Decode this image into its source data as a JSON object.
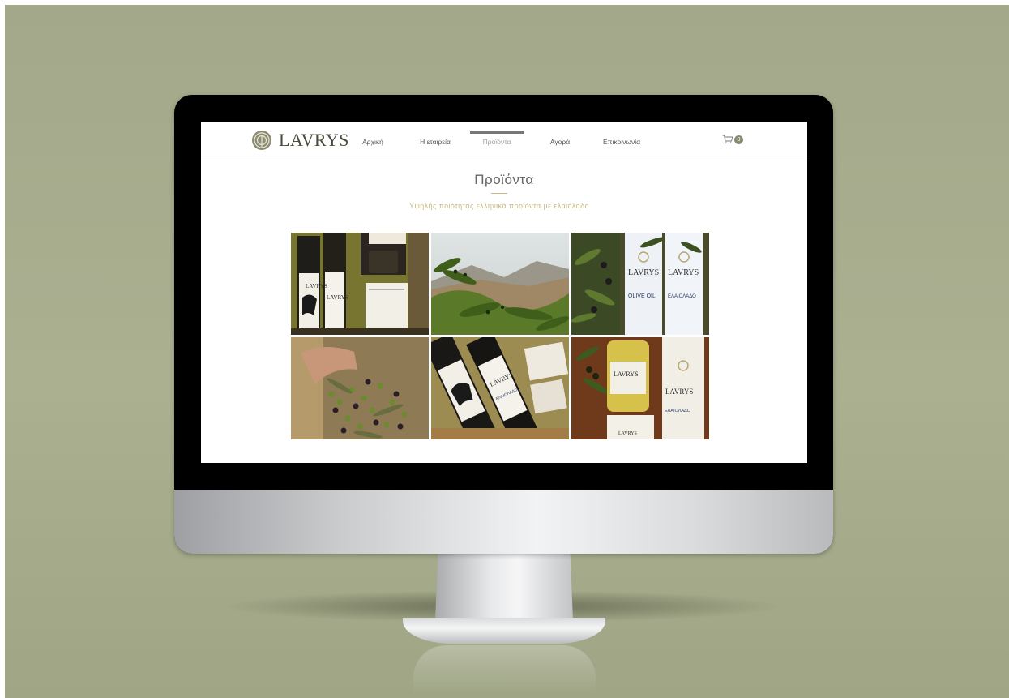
{
  "site": {
    "brand": "LAVRYS",
    "nav": [
      {
        "label": "Αρχική",
        "active": false
      },
      {
        "label": "Η εταιρεία",
        "active": false
      },
      {
        "label": "Προϊόντα",
        "active": true
      },
      {
        "label": "Αγορά",
        "active": false
      },
      {
        "label": "Επικοινωνία",
        "active": false
      }
    ],
    "cart_count": "0"
  },
  "page": {
    "title": "Προϊόντα",
    "subtitle": "Υψηλής ποιότητας ελληνικά προϊόντα με ελαιόλαδο"
  },
  "gallery": {
    "tiles": [
      {
        "name": "gift-box-bottles-photo",
        "bottle_label": "LAVRYS"
      },
      {
        "name": "olive-grove-mountain-photo"
      },
      {
        "name": "olive-oil-bottles-branches-photo",
        "bottle_label": "LAVRYS",
        "product_label": "OLIVE OIL",
        "product_label_gr": "ΕΛΑΙΟΛΑΔΟ"
      },
      {
        "name": "harvested-olives-hand-photo"
      },
      {
        "name": "bottles-in-crate-photo",
        "bottle_label": "LAVRYS",
        "product_label_gr": "ΕΛΑΙΟΛΑΔΟ"
      },
      {
        "name": "oil-jar-and-bottle-photo",
        "bottle_label": "LAVRYS",
        "product_label_gr": "ΕΛΑΙΟΛΑΔΟ"
      }
    ]
  },
  "colors": {
    "background": "#a4a88b",
    "accent": "#c8b982",
    "nav_active_bar": "#777777"
  }
}
